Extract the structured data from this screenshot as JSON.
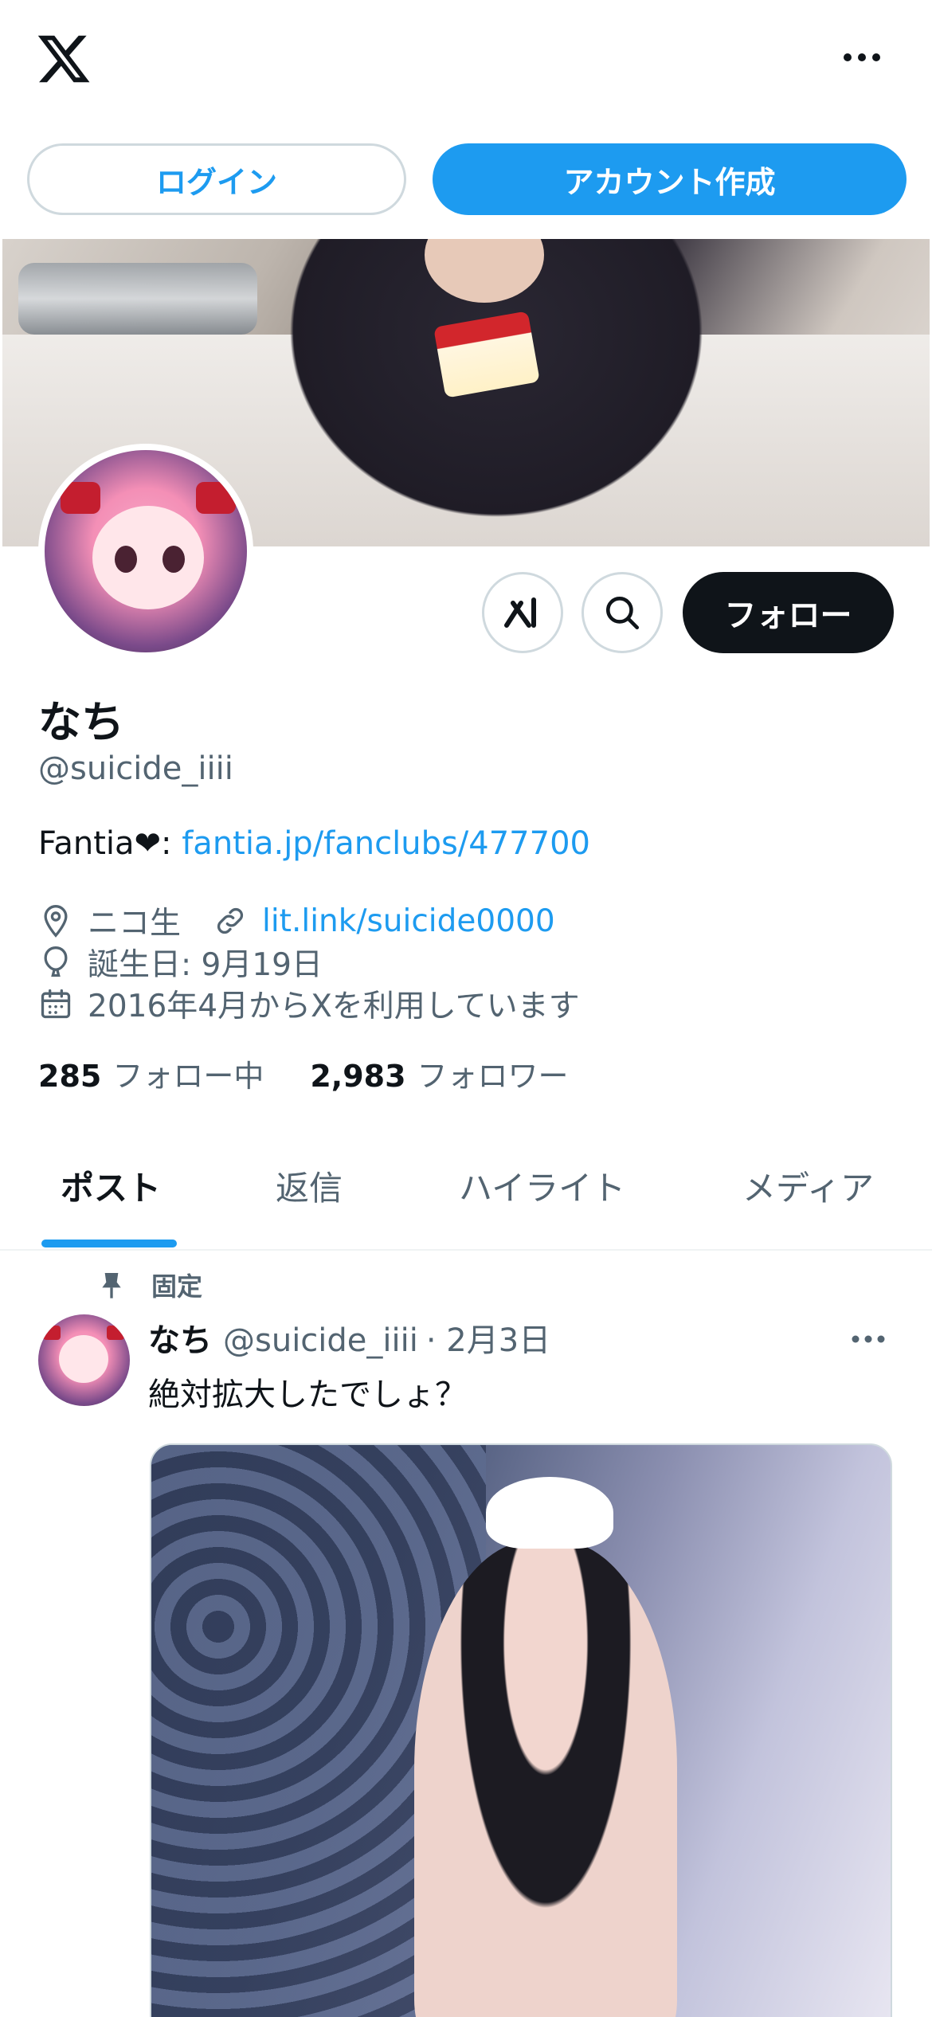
{
  "header": {
    "logo_icon": "x-logo-icon",
    "more_icon": "more-horizontal-icon"
  },
  "auth": {
    "login_label": "ログイン",
    "signup_label": "アカウント作成"
  },
  "actions": {
    "grok_icon": "grok-icon",
    "search_icon": "search-icon",
    "follow_label": "フォロー"
  },
  "profile": {
    "name": "なち",
    "handle": "@suicide_iiii",
    "bio_prefix": "Fantia❤︎: ",
    "bio_link": "fantia.jp/fanclubs/477700",
    "location": "ニコ生",
    "website": "lit.link/suicide0000",
    "birthday": "誕生日: 9月19日",
    "joined": "2016年4月からXを利用しています",
    "following_count": "285",
    "following_label": "フォロー中",
    "followers_count": "2,983",
    "followers_label": "フォロワー"
  },
  "tabs": [
    {
      "label": "ポスト",
      "active": true
    },
    {
      "label": "返信",
      "active": false
    },
    {
      "label": "ハイライト",
      "active": false
    },
    {
      "label": "メディア",
      "active": false
    }
  ],
  "post": {
    "pinned_label": "固定",
    "author_name": "なち",
    "author_handle": "@suicide_iiii",
    "date": "· 2月3日",
    "text": "絶対拡大したでしょ？"
  },
  "colors": {
    "accent": "#1d9bf0",
    "text_primary": "#0f1419",
    "text_secondary": "#536471",
    "border": "#cfd9de"
  }
}
